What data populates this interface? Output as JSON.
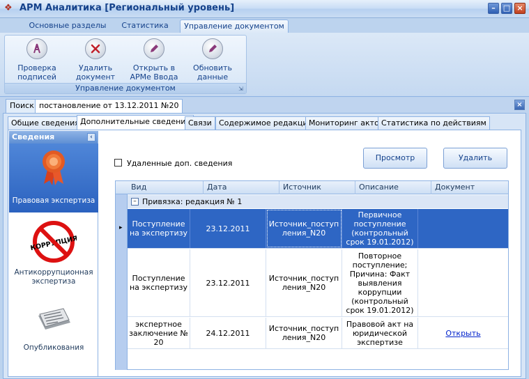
{
  "window": {
    "title": "АРМ Аналитика [Региональный уровень]"
  },
  "ribbon": {
    "tabs": [
      "Основные разделы",
      "Статистика",
      "Управление документом"
    ],
    "group_caption": "Управление документом",
    "buttons": [
      {
        "label": "Проверка подписей",
        "icon": "signature-check-icon"
      },
      {
        "label": "Удалить документ",
        "icon": "delete-x-icon"
      },
      {
        "label": "Открыть в АРМе Ввода",
        "icon": "pencil-icon"
      },
      {
        "label": "Обновить данные",
        "icon": "pencil-icon"
      }
    ]
  },
  "doc_tabs": [
    "Поиск",
    "постановление от 13.12.2011 №20"
  ],
  "inner_tabs": [
    "Общие сведения",
    "Дополнительные сведения",
    "Связи",
    "Содержимое редакций",
    "Мониторинг актов",
    "Статистика по действиям"
  ],
  "leftnav": {
    "header": "Сведения",
    "items": [
      {
        "label": "Правовая экспертиза",
        "icon": "award-ribbon-icon"
      },
      {
        "label": "Антикоррупционная экспертиза",
        "icon": "no-corruption-icon",
        "stamp_text": "КОРРУПЦИЯ"
      },
      {
        "label": "Опубликования",
        "icon": "newspaper-icon"
      }
    ]
  },
  "main": {
    "checkbox_label": "Удаленные доп. сведения",
    "view_button": "Просмотр",
    "delete_button": "Удалить"
  },
  "grid": {
    "columns": [
      "Вид",
      "Дата",
      "Источник",
      "Описание",
      "Документ"
    ],
    "group_label": "Привязка: редакция № 1",
    "group_toggle": "–",
    "rows": [
      {
        "vid": "Поступление на экспертизу",
        "date": "23.12.2011",
        "source": "Источник_поступления_N20",
        "desc": "Первичное поступление (контрольный срок 19.01.2012)",
        "doc": ""
      },
      {
        "vid": "Поступление на экспертизу",
        "date": "23.12.2011",
        "source": "Источник_поступления_N20",
        "desc": "Повторное поступление; Причина: Факт выявления коррупции (контрольный срок 19.01.2012)",
        "doc": ""
      },
      {
        "vid": "экспертное заключение № 20",
        "date": "24.12.2011",
        "source": "Источник_поступления_N20",
        "desc": "Правовой акт на юридической экспертизе",
        "doc": "Открыть"
      }
    ]
  }
}
